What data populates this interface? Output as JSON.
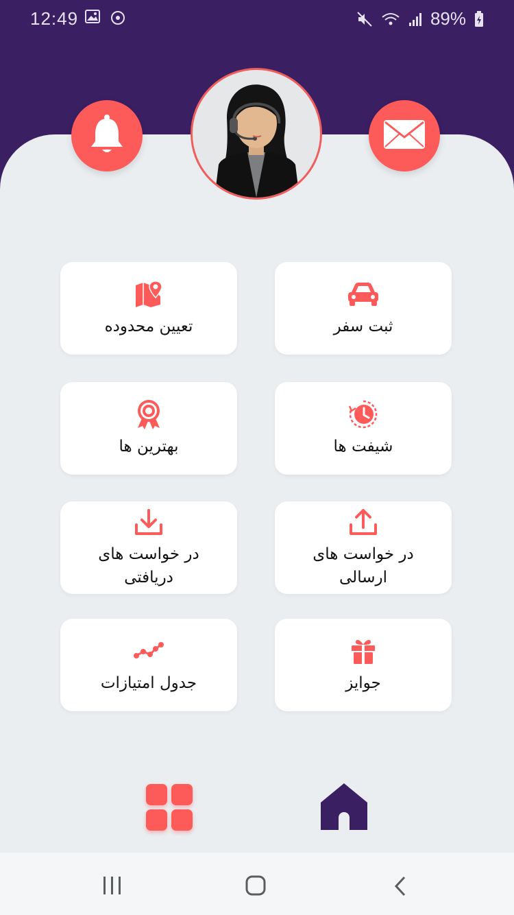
{
  "status_bar": {
    "time": "12:49",
    "battery": "89%",
    "icons": [
      "image-icon",
      "sync-icon",
      "mute-icon",
      "wifi-icon",
      "signal-icon",
      "battery-icon"
    ]
  },
  "header": {
    "notifications_icon": "bell-icon",
    "messages_icon": "envelope-icon",
    "avatar": "support-agent-avatar"
  },
  "tiles": [
    {
      "id": "register-trip",
      "label": "ثبت سفر",
      "icon": "car-icon"
    },
    {
      "id": "set-area",
      "label": "تعیین محدوده",
      "icon": "map-pin-icon"
    },
    {
      "id": "shifts",
      "label": "شیفت ها",
      "icon": "clock-history-icon"
    },
    {
      "id": "top-drivers",
      "label": "بهترین ها",
      "icon": "award-icon"
    },
    {
      "id": "sent-requests",
      "label": "در خواست های ارسالی",
      "icon": "upload-icon"
    },
    {
      "id": "received-requests",
      "label": "در خواست های دریافتی",
      "icon": "download-icon"
    },
    {
      "id": "prizes",
      "label": "جوایز",
      "icon": "gift-icon"
    },
    {
      "id": "points-table",
      "label": "جدول امتیازات",
      "icon": "graph-line-icon"
    }
  ],
  "bottom_nav": {
    "items": [
      {
        "name": "apps",
        "icon": "grid-icon",
        "active": true
      },
      {
        "name": "home",
        "icon": "home-icon",
        "active": false
      }
    ]
  },
  "colors": {
    "header_bg": "#3a1f63",
    "accent": "#fd5a5a",
    "content_bg": "#eaeef0",
    "tile_bg": "#ffffff"
  }
}
